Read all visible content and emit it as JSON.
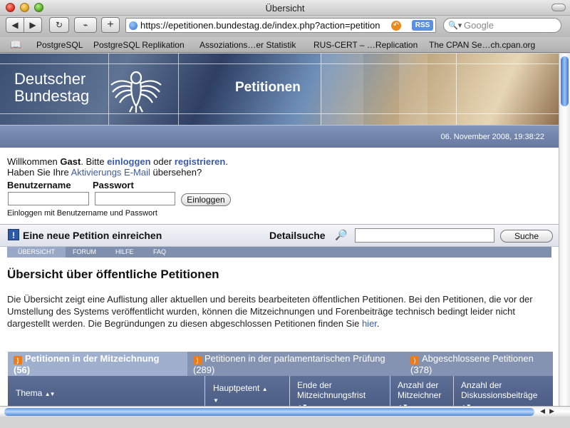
{
  "window": {
    "title": "Übersicht"
  },
  "toolbar": {
    "back_icon": "◀",
    "forward_icon": "▶",
    "reload_icon": "↻",
    "snap_icon": "⌁",
    "add_icon": "+",
    "url": "https://epetitionen.bundestag.de/index.php?action=petition",
    "rss_label": "RSS",
    "search_placeholder": "Google"
  },
  "bookmarks": [
    "PostgreSQL",
    "PostgreSQL Replikation",
    "Assoziations…er Statistik",
    "RUS-CERT – …Replication",
    "The CPAN Se…ch.cpan.org"
  ],
  "header": {
    "brand_line1": "Deutscher",
    "brand_line2": "Bundestag",
    "section": "Petitionen",
    "datetime": "06. November 2008, 19:38:22"
  },
  "login": {
    "welcome_prefix": "Willkommen ",
    "guest": "Gast",
    "welcome_mid": ". Bitte ",
    "login_link": "einloggen",
    "or": " oder ",
    "register_link": "registrieren",
    "period": ".",
    "activation_prefix": "Haben Sie Ihre ",
    "activation_link": "Aktivierungs E-Mail",
    "activation_suffix": " übersehen?",
    "username_label": "Benutzername",
    "password_label": "Passwort",
    "submit_label": "Einloggen",
    "hint": "Einloggen mit Benutzername und Passwort"
  },
  "actions": {
    "new_petition": "Eine neue Petition einreichen",
    "detail_search_label": "Detailsuche",
    "search_button": "Suche"
  },
  "nav": [
    "ÜBERSICHT",
    "FORUM",
    "HILFE",
    "FAQ"
  ],
  "content": {
    "heading": "Übersicht über öffentliche Petitionen",
    "intro_text": "Die Übersicht zeigt eine Auflistung aller aktuellen und bereits bearbeiteten öffentlichen Petitionen. Bei den Petitionen, die vor der Umstellung des Systems veröffentlicht wurden, können die Mitzeichnungen und Forenbeiträge technisch bedingt leider nicht dargestellt werden. Die Begründungen zu diesen abgeschlossen Petitionen finden Sie ",
    "intro_link": "hier",
    "intro_end": "."
  },
  "tabs": [
    {
      "label": "Petitionen in der Mitzeichnung",
      "count": "(56)"
    },
    {
      "label": "Petitionen in der parlamentarischen Prüfung",
      "count": "(289)"
    },
    {
      "label": "Abgeschlossene Petitionen",
      "count": "(378)"
    }
  ],
  "table_headers": {
    "theme": "Thema",
    "petent": "Hauptpetent",
    "deadline_1": "Ende der",
    "deadline_2": "Mitzeichnungsfrist",
    "signers_1": "Anzahl der",
    "signers_2": "Mitzeichner",
    "posts_1": "Anzahl der",
    "posts_2": "Diskussionsbeiträge"
  }
}
